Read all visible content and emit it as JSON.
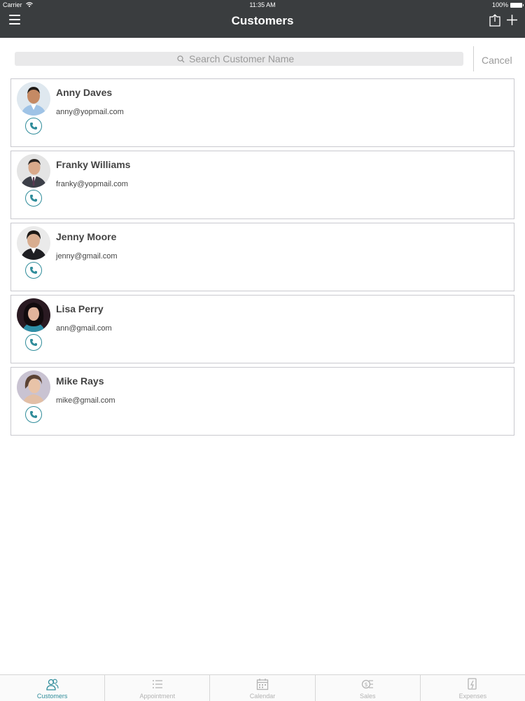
{
  "status": {
    "carrier": "Carrier",
    "time": "11:35 AM",
    "battery": "100%"
  },
  "nav": {
    "title": "Customers",
    "menu_icon": "menu-icon",
    "share_icon": "share-icon",
    "add_icon": "plus-icon"
  },
  "search": {
    "placeholder": "Search Customer Name",
    "value": "",
    "cancel_label": "Cancel"
  },
  "customers": [
    {
      "name": "Anny Daves",
      "email": "anny@yopmail.com"
    },
    {
      "name": "Franky Williams",
      "email": "franky@yopmail.com"
    },
    {
      "name": "Jenny Moore",
      "email": "jenny@gmail.com"
    },
    {
      "name": "Lisa Perry",
      "email": "ann@gmail.com"
    },
    {
      "name": "Mike Rays",
      "email": "mike@gmail.com"
    }
  ],
  "tabs": [
    {
      "label": "Customers",
      "icon": "customers-icon",
      "active": true
    },
    {
      "label": "Appointment",
      "icon": "list-icon",
      "active": false
    },
    {
      "label": "Calendar",
      "icon": "calendar-icon",
      "active": false
    },
    {
      "label": "Sales",
      "icon": "sales-icon",
      "active": false
    },
    {
      "label": "Expenses",
      "icon": "expenses-icon",
      "active": false
    }
  ],
  "colors": {
    "navbar": "#3a3d3f",
    "accent": "#2f8c9a",
    "card_border": "#c9c9cf"
  }
}
